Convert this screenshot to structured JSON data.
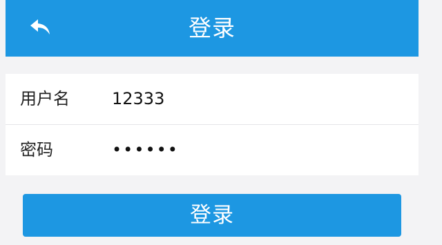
{
  "header": {
    "title": "登录",
    "back_icon": "back-arrow-icon"
  },
  "form": {
    "username_label": "用户名",
    "username_value": "12333",
    "password_label": "密码",
    "password_value": "••••••"
  },
  "actions": {
    "login_label": "登录"
  },
  "colors": {
    "primary": "#1d97e2",
    "background": "#f3f3f5",
    "card": "#ffffff",
    "text": "#222222"
  }
}
